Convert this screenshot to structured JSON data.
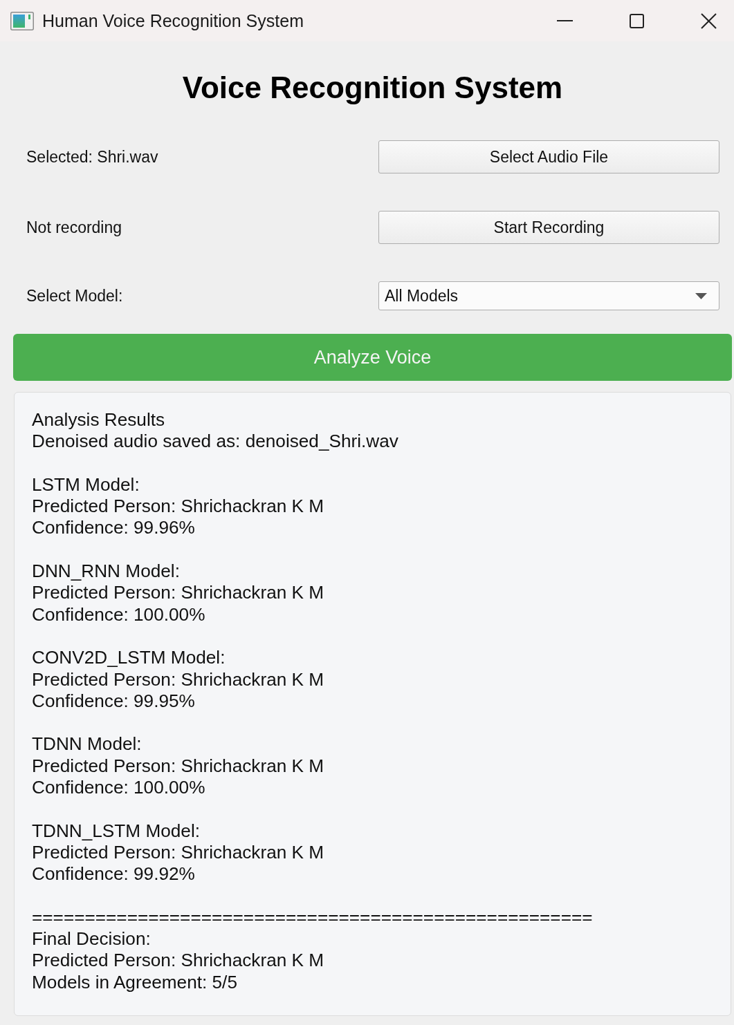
{
  "window": {
    "title": "Human Voice Recognition System"
  },
  "heading": "Voice Recognition System",
  "rows": [
    {
      "kind": "button",
      "label": "Selected: Shri.wav",
      "control": "Select Audio File"
    },
    {
      "kind": "button",
      "label": "Not recording",
      "control": "Start Recording"
    },
    {
      "kind": "dropdown",
      "label": "Select Model:",
      "control": "All Models"
    }
  ],
  "analyze_button": "Analyze Voice",
  "results": {
    "title": "Analysis Results",
    "note": "Denoised audio saved as: denoised_Shri.wav",
    "models": [
      {
        "name": "LSTM Model:",
        "prediction": "Predicted Person: Shrichackran K M",
        "confidence": "Confidence: 99.96%"
      },
      {
        "name": "DNN_RNN Model:",
        "prediction": "Predicted Person: Shrichackran K M",
        "confidence": "Confidence: 100.00%"
      },
      {
        "name": "CONV2D_LSTM Model:",
        "prediction": "Predicted Person: Shrichackran K M",
        "confidence": "Confidence: 99.95%"
      },
      {
        "name": "TDNN Model:",
        "prediction": "Predicted Person: Shrichackran K M",
        "confidence": "Confidence: 100.00%"
      },
      {
        "name": "TDNN_LSTM Model:",
        "prediction": "Predicted Person: Shrichackran K M",
        "confidence": "Confidence: 99.92%"
      }
    ],
    "separator": "=====================================================",
    "final": {
      "title": "Final Decision:",
      "prediction": "Predicted Person: Shrichackran K M",
      "agreement": "Models in Agreement: 5/5"
    }
  }
}
